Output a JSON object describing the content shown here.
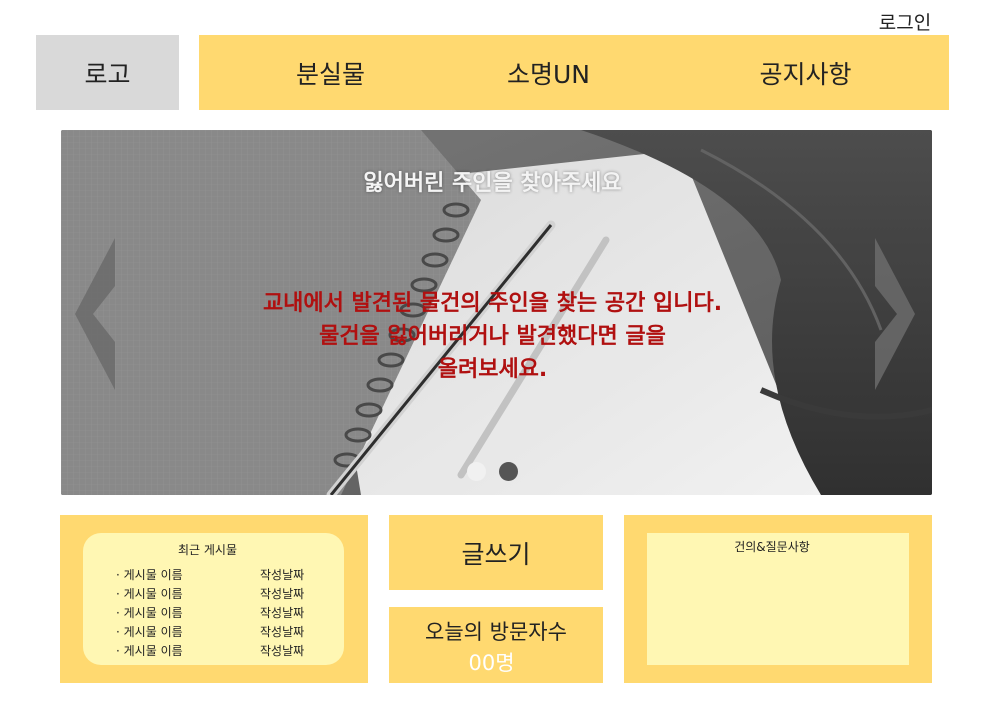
{
  "header": {
    "login_label": "로그인",
    "logo_label": "로고",
    "nav": [
      {
        "label": "분실물"
      },
      {
        "label": "소명UN"
      },
      {
        "label": "공지사항"
      }
    ]
  },
  "hero": {
    "title": "잃어버린 주인을 찾아주세요",
    "lines": [
      "교내에서 발견된 물건의 주인을 찾는 공간 입니다.",
      "물건을 잃어버리거나 발견했다면 글을",
      "올려보세요."
    ],
    "dots": 2,
    "colors": {
      "message": "#b01010",
      "accent": "#ffd970"
    }
  },
  "recent": {
    "title": "최근 게시물",
    "rows": [
      {
        "name": "· 게시물 이름",
        "date": "작성날짜"
      },
      {
        "name": "· 게시물 이름",
        "date": "작성날짜"
      },
      {
        "name": "· 게시물 이름",
        "date": "작성날짜"
      },
      {
        "name": "· 게시물 이름",
        "date": "작성날짜"
      },
      {
        "name": "· 게시물 이름",
        "date": "작성날짜"
      }
    ]
  },
  "write": {
    "label": "글쓰기"
  },
  "visitors": {
    "title": "오늘의 방문자수",
    "count": "00명"
  },
  "qna": {
    "title": "건의&질문사항"
  }
}
